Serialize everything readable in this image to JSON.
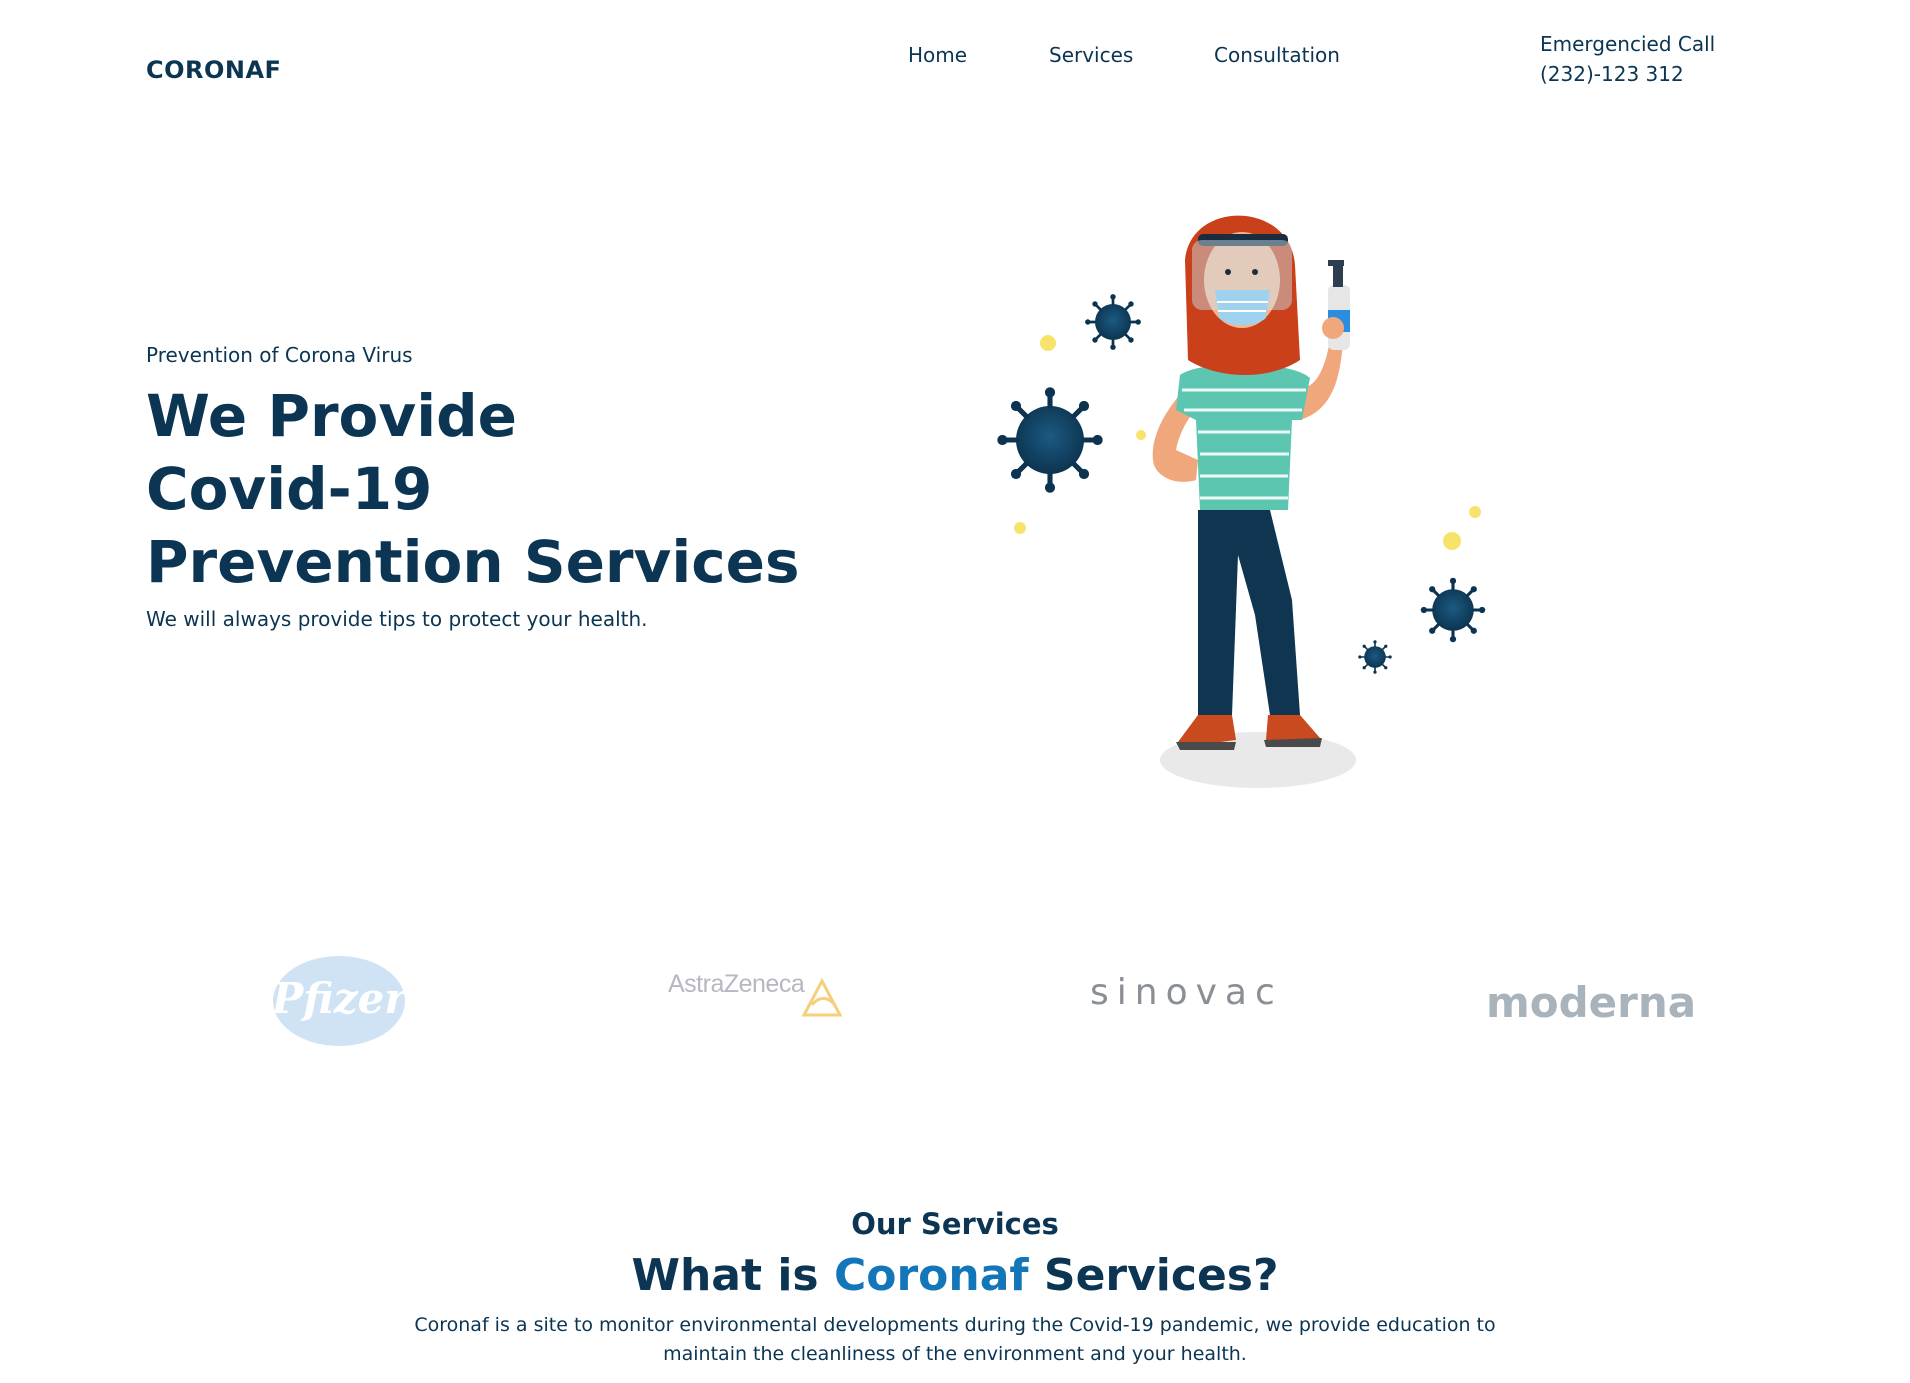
{
  "header": {
    "logo": "CORONAF",
    "nav": [
      {
        "label": "Home"
      },
      {
        "label": "Services"
      },
      {
        "label": "Consultation"
      }
    ],
    "call_label": "Emergencied Call",
    "call_number": "(232)-123 312"
  },
  "hero": {
    "kicker": "Prevention of Corona Virus",
    "title_lines": [
      "We Provide",
      "Covid-19",
      "Prevention Services"
    ],
    "subtitle": "We will always provide tips to protect your health.",
    "illustration": "woman-with-mask-and-sanitizer-illustration"
  },
  "brands": {
    "pfizer": "Pfizer",
    "astrazeneca": "AstraZeneca",
    "sinovac": "sinovac",
    "moderna": "moderna"
  },
  "services": {
    "kicker": "Our Services",
    "title_prefix": "What is",
    "title_accent": "Coronaf",
    "title_suffix": "Services?",
    "description": "Coronaf is a site to monitor environmental developments during the Covid-19 pandemic, we provide education to maintain the cleanliness of the environment and your health."
  },
  "colors": {
    "primary": "#0b3552",
    "accent": "#1376b9",
    "virus": "#0f3f5f",
    "shirt": "#5cc6b0",
    "hair": "#c9401a"
  }
}
